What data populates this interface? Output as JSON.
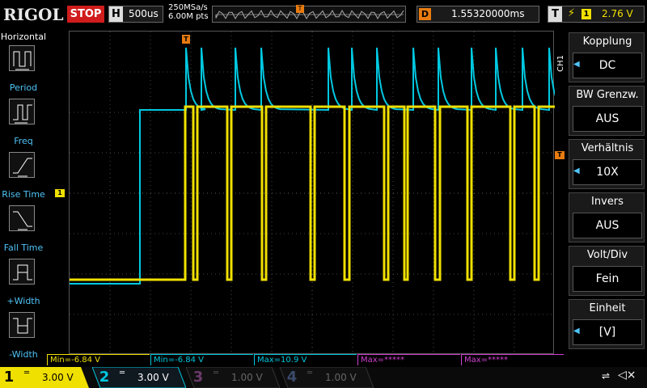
{
  "topbar": {
    "logo": "RIGOL",
    "run_state": "STOP",
    "timebase": {
      "key": "H",
      "value": "500us"
    },
    "sample_rate": "250MSa/s",
    "memory_depth": "6.00M pts",
    "trigger_marker": "T",
    "delay": {
      "key": "D",
      "value": "1.55320000ms"
    },
    "trigger": {
      "key": "T",
      "edge_icon": "rising-edge-icon",
      "edge_glyph": "⚡",
      "source": "1",
      "level": "2.76 V"
    }
  },
  "left_panel": {
    "title": "Horizontal",
    "items": [
      {
        "label": "Period",
        "icon": "period-icon"
      },
      {
        "label": "Freq",
        "icon": "freq-icon"
      },
      {
        "label": "Rise Time",
        "icon": "rise-time-icon"
      },
      {
        "label": "Fall Time",
        "icon": "fall-time-icon"
      },
      {
        "label": "+Width",
        "icon": "plus-width-icon"
      },
      {
        "label": "-Width",
        "icon": "minus-width-icon"
      }
    ]
  },
  "right_panel": {
    "channel_tag": "CH1",
    "items": [
      {
        "title": "Kopplung",
        "value": "DC",
        "has_arrow": true
      },
      {
        "title": "BW Grenzw.",
        "value": "AUS",
        "has_arrow": false
      },
      {
        "title": "Verhältnis",
        "value": "10X",
        "has_arrow": true
      },
      {
        "title": "Invers",
        "value": "AUS",
        "has_arrow": false
      },
      {
        "title": "Volt/Div",
        "value": "Fein",
        "has_arrow": false
      },
      {
        "title": "Einheit",
        "value": "[V]",
        "has_arrow": true
      }
    ]
  },
  "screen": {
    "ch1_marker": "1",
    "trigger_level_marker": "T",
    "top_trigger_marker": "T"
  },
  "measurements": [
    {
      "text": "Min=-6.84 V",
      "color": "#f0e000"
    },
    {
      "text": "Min=-6.84 V",
      "color": "#00c8e0"
    },
    {
      "text": "Max=10.9 V",
      "color": "#00c8e0"
    },
    {
      "text": "Max=*****",
      "color": "#d040d0"
    },
    {
      "text": "Max=*****",
      "color": "#d040d0"
    }
  ],
  "channels": [
    {
      "num": "1",
      "coupling": "═",
      "scale": "3.00 V",
      "color": "#f0e000",
      "active": true
    },
    {
      "num": "2",
      "coupling": "═",
      "scale": "3.00 V",
      "color": "#00c8e0",
      "active": true
    },
    {
      "num": "3",
      "coupling": "═",
      "scale": "1.00 V",
      "color": "#d040d0",
      "active": false
    },
    {
      "num": "4",
      "coupling": "═",
      "scale": "1.00 V",
      "color": "#3070d0",
      "active": false
    }
  ],
  "status_icons": {
    "usb": "usb-icon",
    "usb_glyph": "⇌",
    "speaker": "speaker-muted-icon",
    "speaker_glyph": "◁×"
  },
  "colors": {
    "ch1": "#f0e000",
    "ch2": "#00c8e0",
    "accent": "#e87b10",
    "stop": "#d01c1c",
    "label": "#4fc3f7"
  }
}
